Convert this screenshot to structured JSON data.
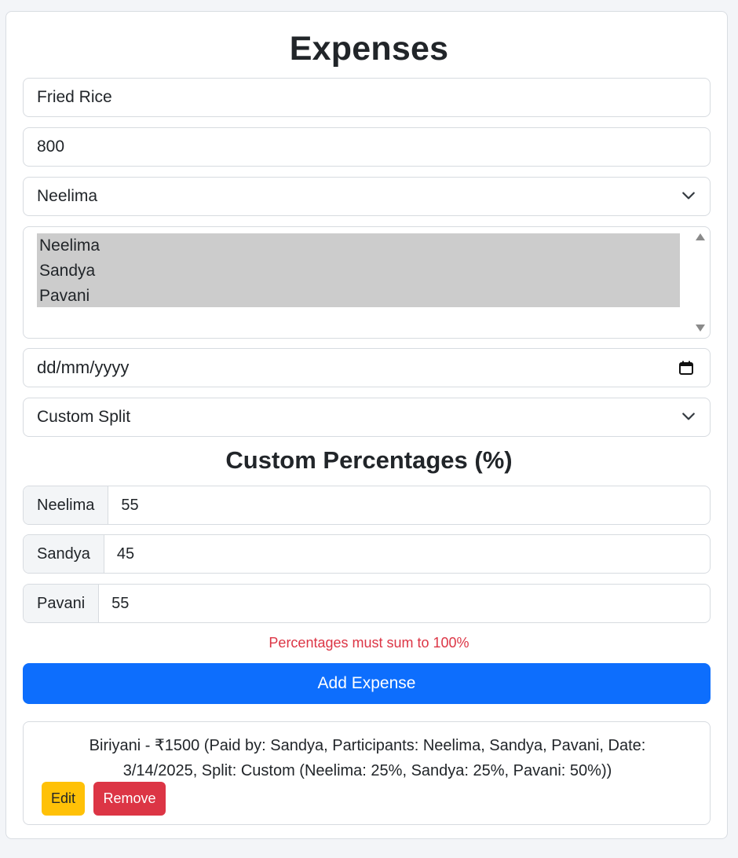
{
  "title": "Expenses",
  "form": {
    "description_value": "Fried Rice",
    "amount_value": "800",
    "paid_by_selected": "Neelima",
    "participants": [
      "Neelima",
      "Sandya",
      "Pavani"
    ],
    "date_placeholder": "dd/mm/yyyy",
    "split_type_selected": "Custom Split"
  },
  "custom": {
    "heading": "Custom Percentages (%)",
    "rows": [
      {
        "name": "Neelima",
        "value": "55"
      },
      {
        "name": "Sandya",
        "value": "45"
      },
      {
        "name": "Pavani",
        "value": "55"
      }
    ],
    "error": "Percentages must sum to 100%"
  },
  "add_button_label": "Add Expense",
  "expenses": [
    {
      "text": "Biriyani - ₹1500 (Paid by: Sandya, Participants: Neelima, Sandya, Pavani, Date: 3/14/2025, Split: Custom (Neelima: 25%, Sandya: 25%, Pavani: 50%))",
      "edit_label": "Edit",
      "remove_label": "Remove"
    }
  ],
  "icons": {
    "select_arrow": "chevron-down-icon",
    "date_picker": "calendar-icon",
    "scroll_up": "scroll-up-arrow-icon",
    "scroll_down": "scroll-down-arrow-icon"
  },
  "colors": {
    "primary": "#0d6efd",
    "danger": "#dc3545",
    "warning": "#ffc107",
    "selected_option": "#cccccc"
  }
}
